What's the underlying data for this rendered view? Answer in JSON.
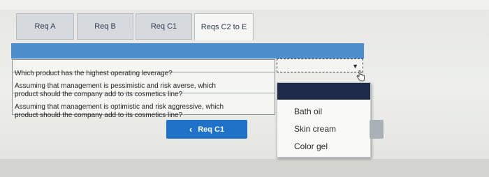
{
  "tabs": [
    {
      "label": "Req A"
    },
    {
      "label": "Req B"
    },
    {
      "label": "Req C1"
    },
    {
      "label": "Reqs C2 to E"
    }
  ],
  "active_tab": "Reqs C2 to E",
  "question_rows": [
    {
      "text": "Which product has the highest operating leverage?"
    },
    {
      "text": "Assuming that management is pessimistic and risk averse, which\nproduct should the company add to its cosmetics line?"
    },
    {
      "text": "Assuming that management is optimistic and risk aggressive, which\nproduct should the company add to its cosmetics line?"
    }
  ],
  "dropdown": {
    "selected_value": "",
    "options": [
      "",
      "Bath oil",
      "Skin cream",
      "Color gel"
    ]
  },
  "buttons": {
    "prev_label": "Req C1"
  },
  "colors": {
    "header_blue": "#4f8ecc",
    "button_blue": "#1f72c8",
    "dropdown_highlight": "#1e2a4a"
  }
}
